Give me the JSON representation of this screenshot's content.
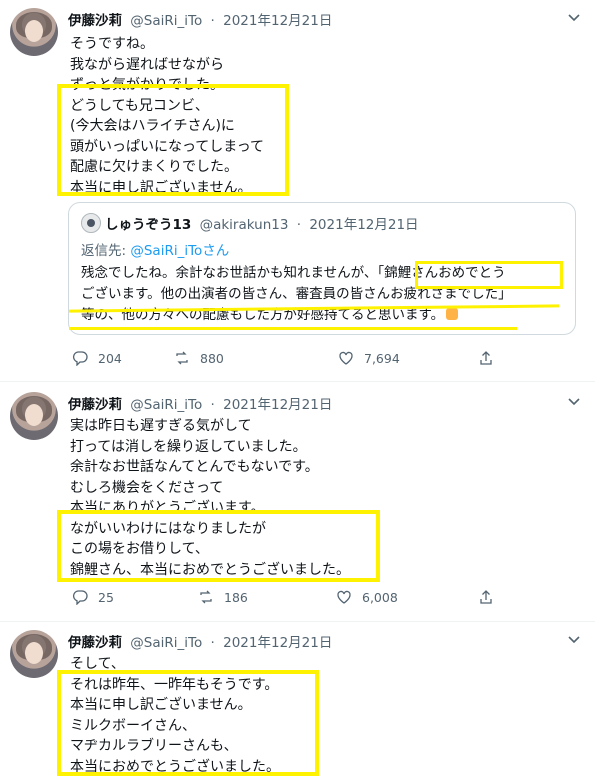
{
  "tweets": [
    {
      "name": "伊藤沙莉",
      "handle": "@SaiRi_iTo",
      "date": "2021年12月21日",
      "lines": [
        "そうですね。",
        "我ながら遅ればせながら",
        "ずっと気がかりでした。",
        "どうしても兄コンビ、",
        "(今大会はハライチさん)に",
        "頭がいっぱいになってしまって",
        "配慮に欠けまくりでした。",
        "本当に申し訳ございません。"
      ],
      "quote": {
        "name": "しゅうぞう13",
        "handle": "@akirakun13",
        "date": "2021年12月21日",
        "reply_label": "返信先:",
        "reply_handle": "@SaiRi_iToさん",
        "lines": [
          "残念でしたね。余計なお世話かも知れませんが、「錦鯉さんおめでとう",
          "ございます。他の出演者の皆さん、審査員の皆さんお疲れさまでした」",
          "等の、他の方々への配慮もした方が好感持てると思います。"
        ]
      },
      "stats": {
        "replies": "204",
        "retweets": "880",
        "likes": "7,694"
      }
    },
    {
      "name": "伊藤沙莉",
      "handle": "@SaiRi_iTo",
      "date": "2021年12月21日",
      "lines": [
        "実は昨日も遅すぎる気がして",
        "打っては消しを繰り返していました。",
        "余計なお世話なんてとんでもないです。",
        "むしろ機会をくださって",
        "本当にありがとうございます。",
        "ながいいわけにはなりましたが",
        "この場をお借りして、",
        "錦鯉さん、本当におめでとうございました。"
      ],
      "stats": {
        "replies": "25",
        "retweets": "186",
        "likes": "6,008"
      }
    },
    {
      "name": "伊藤沙莉",
      "handle": "@SaiRi_iTo",
      "date": "2021年12月21日",
      "lines": [
        "そして、",
        "それは昨年、一昨年もそうです。",
        "本当に申し訳ございません。",
        "ミルクボーイさん、",
        "マヂカルラブリーさんも、",
        "本当におめでとうございました。"
      ]
    }
  ],
  "icons": {
    "more": "chevron-down-icon",
    "reply": "reply-icon",
    "retweet": "retweet-icon",
    "like": "heart-icon",
    "share": "share-icon"
  },
  "colors": {
    "highlight": "#fff200",
    "link": "#1d9bf0",
    "secondary": "#536471",
    "border": "#cfd9de"
  }
}
